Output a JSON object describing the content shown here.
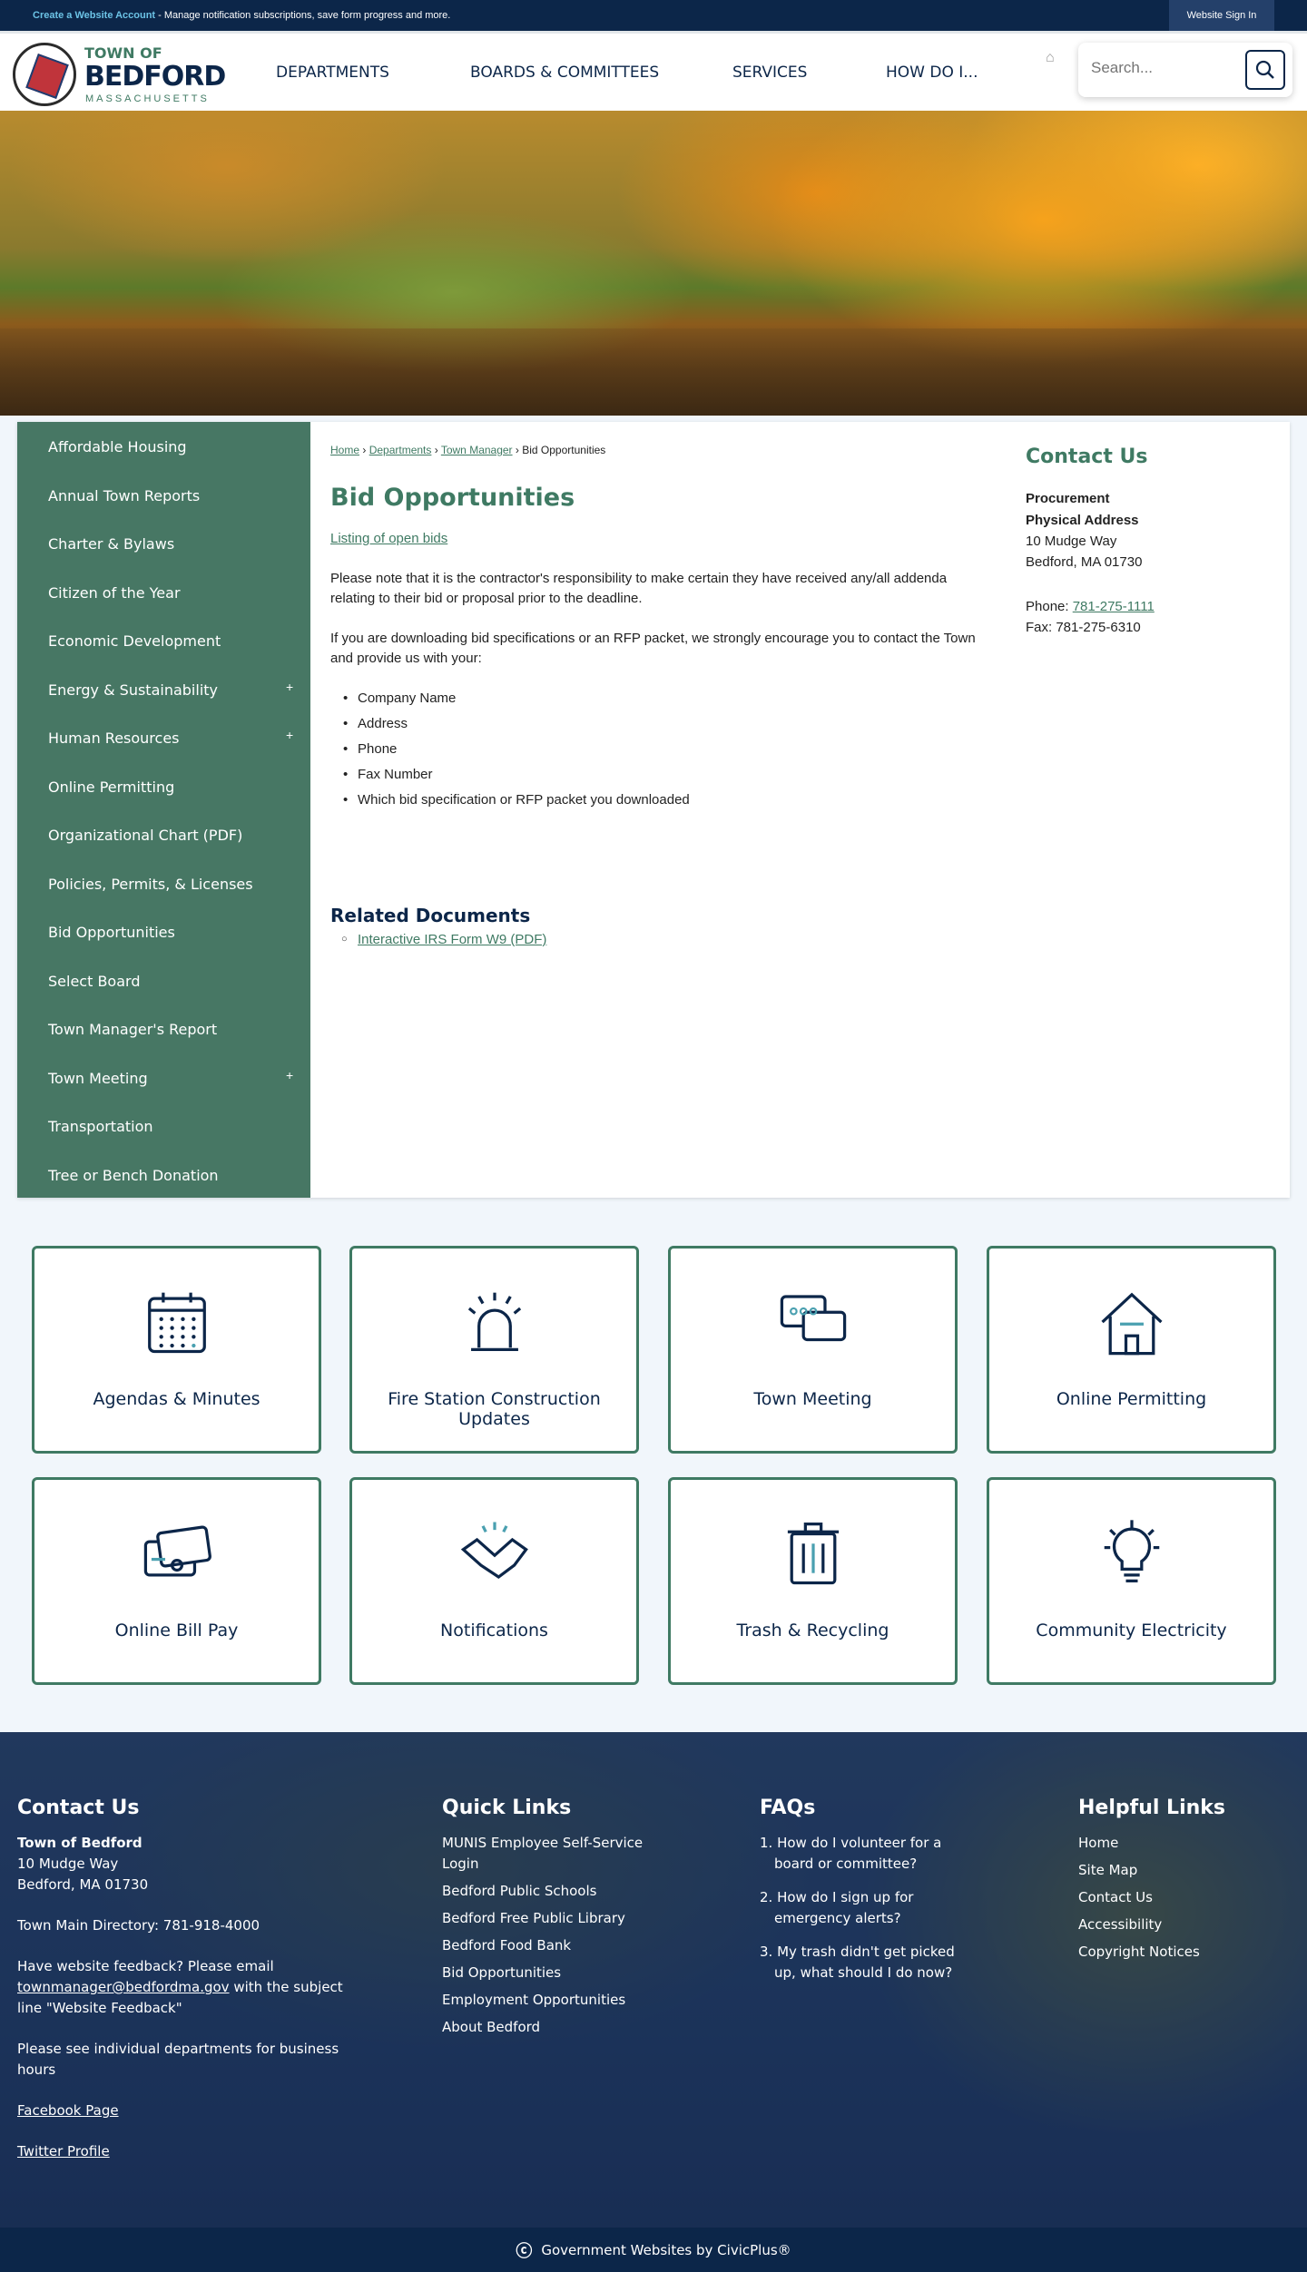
{
  "topbar": {
    "create_account": "Create a Website Account",
    "message": " - Manage notification subscriptions, save form progress and more.",
    "sign_in": "Website Sign In"
  },
  "logo": {
    "line1": "TOWN OF",
    "line2": "BEDFORD",
    "line3": "MASSACHUSETTS"
  },
  "nav": [
    "DEPARTMENTS",
    "BOARDS & COMMITTEES",
    "SERVICES",
    "HOW DO I..."
  ],
  "search": {
    "placeholder": "Search..."
  },
  "sidebar": [
    {
      "label": "Affordable Housing"
    },
    {
      "label": "Annual Town Reports"
    },
    {
      "label": "Charter & Bylaws"
    },
    {
      "label": "Citizen of the Year"
    },
    {
      "label": "Economic Development"
    },
    {
      "label": "Energy & Sustainability",
      "expand": "+"
    },
    {
      "label": "Human Resources",
      "expand": "+"
    },
    {
      "label": "Online Permitting"
    },
    {
      "label": "Organizational Chart (PDF)"
    },
    {
      "label": "Policies, Permits, & Licenses"
    },
    {
      "label": "Bid Opportunities"
    },
    {
      "label": "Select Board"
    },
    {
      "label": "Town Manager's Report"
    },
    {
      "label": "Town Meeting",
      "expand": "+"
    },
    {
      "label": "Transportation"
    },
    {
      "label": "Tree or Bench Donation"
    }
  ],
  "breadcrumb": {
    "home": "Home",
    "departments": "Departments",
    "town_manager": "Town Manager",
    "current": "Bid Opportunities"
  },
  "main": {
    "title": "Bid Opportunities",
    "link": "Listing of open bids",
    "para1": "Please note that it is the contractor's responsibility to make certain they have received any/all addenda relating to their bid or proposal prior to the deadline.",
    "para2": "If you are downloading bid specifications or an RFP packet, we strongly encourage you to contact the Town and provide us with your:",
    "bullets": [
      "Company Name",
      "Address",
      "Phone",
      "Fax Number",
      "Which bid specification or RFP packet you downloaded"
    ],
    "related_title": "Related Documents",
    "related_doc": "Interactive IRS Form W9 (PDF)"
  },
  "contact": {
    "title": "Contact Us",
    "dept": "Procurement",
    "addr_label": "Physical Address",
    "street": "10 Mudge Way",
    "city": "Bedford, MA 01730",
    "phone_label": "Phone: ",
    "phone": "781-275-1111",
    "fax": "Fax: 781-275-6310"
  },
  "tiles": [
    "Agendas & Minutes",
    "Fire Station Construction Updates",
    "Town Meeting",
    "Online Permitting",
    "Online Bill Pay",
    "Notifications",
    "Trash & Recycling",
    "Community Electricity"
  ],
  "footer": {
    "contact": {
      "title": "Contact Us",
      "name": "Town of Bedford",
      "street": "10 Mudge Way",
      "city": "Bedford, MA 01730",
      "directory": "Town Main Directory: 781-918-4000",
      "feedback1": "Have website feedback? Please email ",
      "email": "townmanager@bedfordma.gov",
      "feedback2": " with the subject line \"Website Feedback\"",
      "hours": "Please see individual departments for business hours",
      "facebook": "Facebook Page",
      "twitter": "Twitter Profile"
    },
    "quick": {
      "title": "Quick Links",
      "items": [
        "MUNIS Employee Self-Service Login",
        "Bedford Public Schools",
        "Bedford Free Public Library",
        "Bedford Food Bank",
        "Bid Opportunities",
        "Employment Opportunities",
        "About Bedford"
      ]
    },
    "faqs": {
      "title": "FAQs",
      "items": [
        "How do I volunteer for a board or committee?",
        "How do I sign up for emergency alerts?",
        "My trash didn't get picked up, what should I do now?"
      ]
    },
    "helpful": {
      "title": "Helpful Links",
      "items": [
        "Home",
        "Site Map",
        "Contact Us",
        "Accessibility",
        "Copyright Notices"
      ]
    }
  },
  "bottom": {
    "text": "Government Websites by CivicPlus®"
  }
}
